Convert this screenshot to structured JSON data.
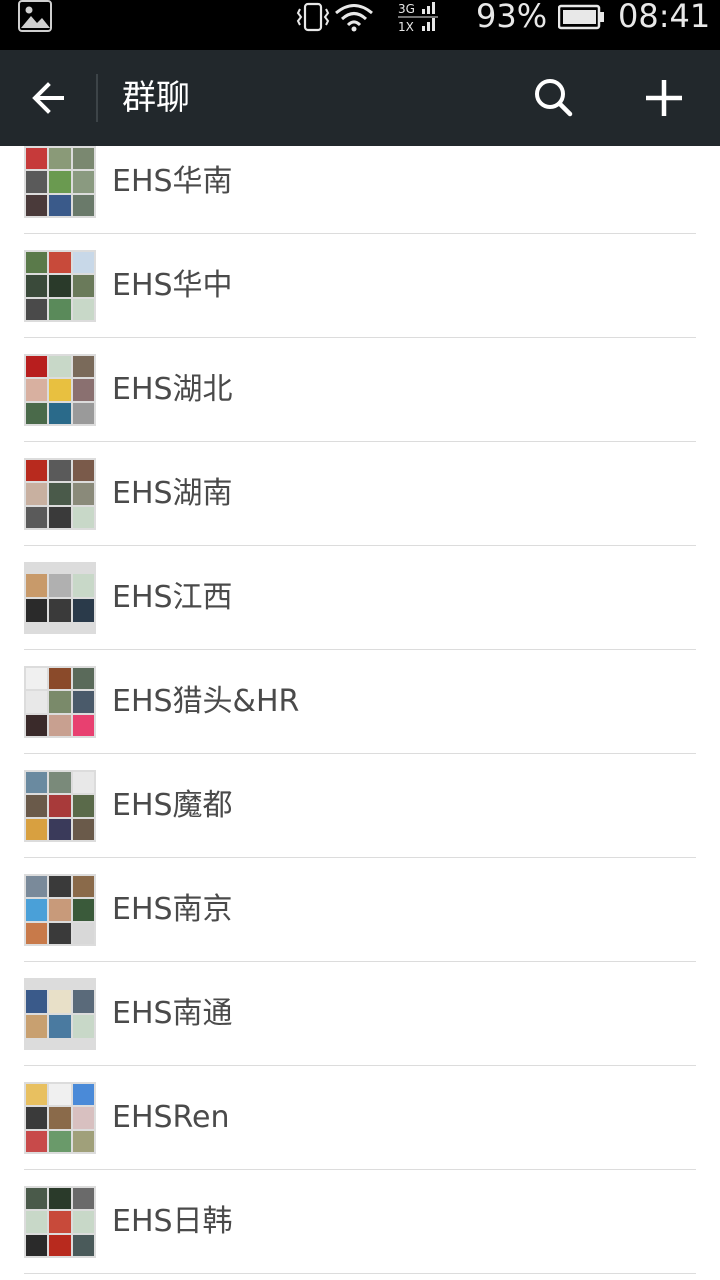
{
  "status_bar": {
    "network": "3G",
    "network_sub": "1X",
    "battery_percent": "93%",
    "time": "08:41",
    "icons": [
      "gallery-icon",
      "vibrate-icon",
      "wifi-icon",
      "signal-icon",
      "battery-icon"
    ]
  },
  "action_bar": {
    "title": "群聊",
    "icons": [
      "back-arrow-icon",
      "search-icon",
      "plus-icon"
    ]
  },
  "colors": {
    "status_bar_bg": "#000000",
    "action_bar_bg": "#22282c",
    "list_bg": "#ffffff",
    "group_name_text": "#4a4a4a",
    "divider": "#dcdcdc"
  },
  "groups": [
    {
      "name": "EHS华南",
      "avatar_tiles": [
        "#c63a3a",
        "#8a9a78",
        "#7a8870",
        "#5a5a5a",
        "#6a9a50",
        "#8a9a80",
        "#4a3a3a",
        "#3a5a8a",
        "#6a7a6a"
      ]
    },
    {
      "name": "EHS华中",
      "avatar_tiles": [
        "#5a7a4a",
        "#c84a3a",
        "#c8d8e8",
        "#3a4a3a",
        "#2a3a2a",
        "#6a7a5a",
        "#4a4a4a",
        "#5a8a5a",
        "#c8d8c8"
      ]
    },
    {
      "name": "EHS湖北",
      "avatar_tiles": [
        "#b81e1e",
        "#c8d8c8",
        "#7a6a5a",
        "#d8b0a0",
        "#e8c040",
        "#8a7070",
        "#4a6a4a",
        "#2a6a8a",
        "#9a9a9a"
      ]
    },
    {
      "name": "EHS湖南",
      "avatar_tiles": [
        "#b82a1e",
        "#5a5a5a",
        "#7a5a4a",
        "#c8b0a0",
        "#4a5a4a",
        "#8a8a7a",
        "#5a5a5a",
        "#3a3a3a",
        "#c8d8c8"
      ]
    },
    {
      "name": "EHS江西",
      "avatar_tiles": [
        "#c89a6a",
        "#b0b0b0",
        "#c8d8c8",
        "#2a2a2a",
        "#3a3a3a",
        "#2a3a4a"
      ]
    },
    {
      "name": "EHS猎头&HR",
      "avatar_tiles": [
        "#f0f0f0",
        "#8a4a2a",
        "#5a6a5a",
        "#e8e8e8",
        "#7a8a6a",
        "#4a5a6a",
        "#3a2a2a",
        "#c8a090",
        "#e84070"
      ]
    },
    {
      "name": "EHS魔都",
      "avatar_tiles": [
        "#6a8aa0",
        "#7a8a7a",
        "#e8e8e8",
        "#6a5a4a",
        "#a83a3a",
        "#5a6a4a",
        "#d8a040",
        "#3a3a5a",
        "#6a5a4a"
      ]
    },
    {
      "name": "EHS南京",
      "avatar_tiles": [
        "#7a8a9a",
        "#3a3a3a",
        "#8a6a4a",
        "#4aa0d8",
        "#c89a7a",
        "#3a5a3a",
        "#c87a4a",
        "#3a3a3a",
        "#d8d8d8"
      ]
    },
    {
      "name": "EHS南通",
      "avatar_tiles": [
        "#3a5a8a",
        "#e8e0c8",
        "#5a6a7a",
        "#c8a070",
        "#4a7aa0",
        "#c8d8c8"
      ]
    },
    {
      "name": "EHSRen",
      "avatar_tiles": [
        "#e8c060",
        "#f0f0f0",
        "#4a8ad8",
        "#3a3a3a",
        "#8a6a4a",
        "#d8c0c0",
        "#c84a4a",
        "#6a9a6a",
        "#a0a07a"
      ]
    },
    {
      "name": "EHS日韩",
      "avatar_tiles": [
        "#4a5a4a",
        "#2a3a2a",
        "#6a6a6a",
        "#c8d8c8",
        "#c84a3a",
        "#c8d8c8",
        "#2a2a2a",
        "#b82a1e",
        "#4a5a5a"
      ]
    }
  ]
}
